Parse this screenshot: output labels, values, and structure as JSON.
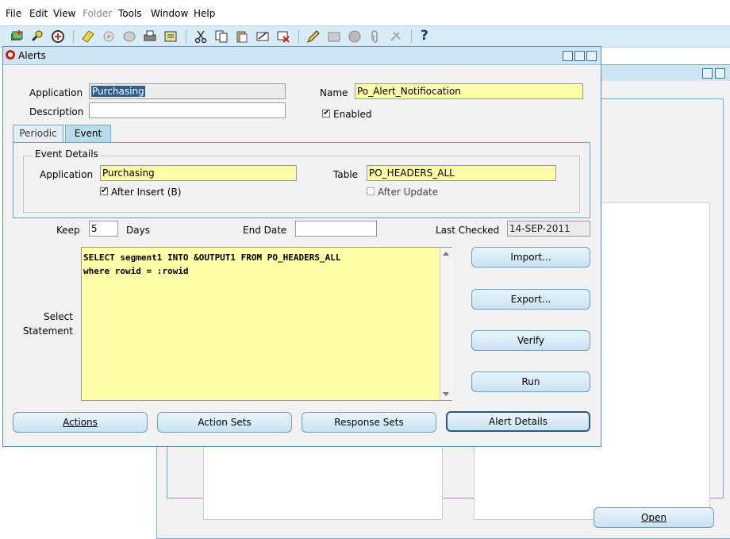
{
  "menubar": {
    "items": [
      {
        "label": "File",
        "disabled": false
      },
      {
        "label": "Edit",
        "disabled": false
      },
      {
        "label": "View",
        "disabled": false
      },
      {
        "label": "Folder",
        "disabled": true
      },
      {
        "label": "Tools",
        "disabled": false
      },
      {
        "label": "Window",
        "disabled": false
      },
      {
        "label": "Help",
        "disabled": false
      }
    ]
  },
  "toolbar": {
    "icons": [
      "new-record-icon",
      "find-icon",
      "navigator-icon",
      "save-icon",
      "next-step-icon",
      "switch-responsibility-icon",
      "print-icon",
      "close-form-icon",
      "cut-icon",
      "copy-icon",
      "paste-icon",
      "clear-record-icon",
      "delete-record-icon",
      "edit-field-icon",
      "zoom-icon",
      "translations-icon",
      "attachments-icon",
      "folder-tools-icon",
      "help-icon"
    ],
    "help_label": "?"
  },
  "alerts_window": {
    "title": "Alerts",
    "application_label": "Application",
    "application_value": "Purchasing",
    "description_label": "Description",
    "description_value": "",
    "name_label": "Name",
    "name_value": "Po_Alert_Notifiocation",
    "enabled_label": "Enabled",
    "enabled_checked": true,
    "tabs": [
      {
        "label": "Periodic",
        "active": false
      },
      {
        "label": "Event",
        "active": true
      }
    ],
    "event_details": {
      "title": "Event Details",
      "application_label": "Application",
      "application_value": "Purchasing",
      "table_label": "Table",
      "table_value": "PO_HEADERS_ALL",
      "after_insert_label": "After Insert (B)",
      "after_insert_checked": true,
      "after_update_label": "After Update",
      "after_update_checked": false
    },
    "keep_label": "Keep",
    "keep_value": "5",
    "days_label": "Days",
    "end_date_label": "End Date",
    "end_date_value": "",
    "last_checked_label": "Last Checked",
    "last_checked_value": "14-SEP-2011",
    "select_statement_label_1": "Select",
    "select_statement_label_2": "Statement",
    "select_statement": "SELECT segment1 INTO &OUTPUT1 FROM PO_HEADERS_ALL\nwhere rowid = :rowid",
    "side_buttons": {
      "import": "Import...",
      "export": "Export...",
      "verify": "Verify",
      "run": "Run"
    },
    "bottom_buttons": {
      "actions": "Actions",
      "action_sets": "Action Sets",
      "response_sets": "Response Sets",
      "alert_details": "Alert Details"
    }
  },
  "background_window": {
    "open_button": "Open"
  }
}
